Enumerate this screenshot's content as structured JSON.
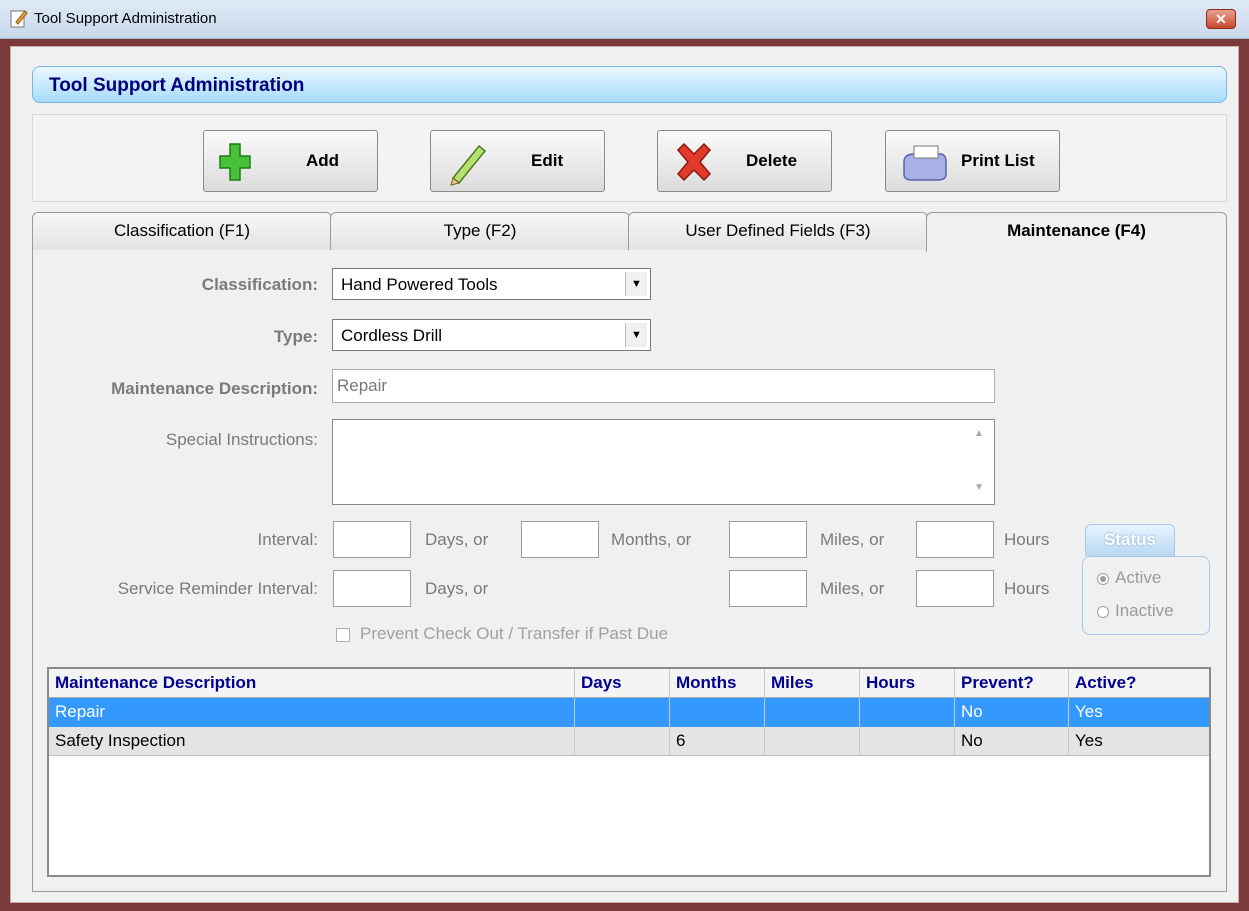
{
  "window": {
    "title": "Tool Support Administration",
    "close_glyph": "✕"
  },
  "header": {
    "title": "Tool Support Administration"
  },
  "toolbar": {
    "add_label": "Add",
    "edit_label": "Edit",
    "delete_label": "Delete",
    "print_label": "Print List"
  },
  "tabs": [
    {
      "label": "Classification (F1)"
    },
    {
      "label": "Type (F2)"
    },
    {
      "label": "User Defined Fields (F3)"
    },
    {
      "label": "Maintenance (F4)"
    }
  ],
  "form": {
    "classification_label": "Classification:",
    "classification_value": "Hand Powered Tools",
    "type_label": "Type:",
    "type_value": "Cordless Drill",
    "maint_desc_label": "Maintenance Description:",
    "maint_desc_value": "Repair",
    "special_instructions_label": "Special Instructions:",
    "interval_label": "Interval:",
    "service_reminder_label": "Service Reminder Interval:",
    "days_or": "Days, or",
    "months_or": "Months, or",
    "miles_or": "Miles, or",
    "hours": "Hours",
    "prevent_checkout_label": "Prevent Check Out / Transfer if Past Due"
  },
  "status": {
    "title": "Status",
    "active_label": "Active",
    "inactive_label": "Inactive"
  },
  "grid": {
    "columns": [
      "Maintenance Description",
      "Days",
      "Months",
      "Miles",
      "Hours",
      "Prevent?",
      "Active?"
    ],
    "rows": [
      [
        "Repair",
        "",
        "",
        "",
        "",
        "No",
        "Yes"
      ],
      [
        "Safety Inspection",
        "",
        "6",
        "",
        "",
        "No",
        "Yes"
      ]
    ]
  },
  "colors": {
    "header_text": "#00007a",
    "grid_header_text": "#000090",
    "selected_row": "#3399ff"
  }
}
